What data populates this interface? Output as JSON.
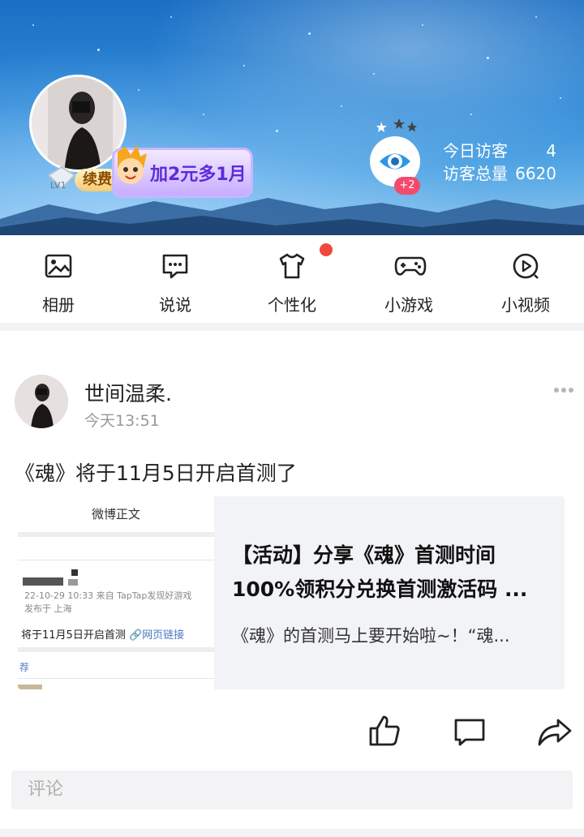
{
  "profile": {
    "level": "LV1",
    "renew_label": "续费",
    "promo_text": "加2元多1月",
    "visitor_badge": "+2",
    "today_visitors_label": "今日访客",
    "today_visitors_value": "4",
    "total_visitors_label": "访客总量",
    "total_visitors_value": "6620"
  },
  "nav": {
    "items": [
      {
        "label": "相册",
        "icon": "photo-album-icon"
      },
      {
        "label": "说说",
        "icon": "chat-bubble-icon"
      },
      {
        "label": "个性化",
        "icon": "tshirt-icon",
        "has_dot": true
      },
      {
        "label": "小游戏",
        "icon": "gamepad-icon"
      },
      {
        "label": "小视频",
        "icon": "play-circle-icon"
      }
    ]
  },
  "post": {
    "author": "世间温柔.",
    "time": "今天13:51",
    "text": "《魂》将于11月5日开启首测了",
    "card": {
      "thumb_header": "微博正文",
      "thumb_meta1": "22-10-29 10:33  来自 TapTap发现好游戏",
      "thumb_meta2": "发布于 上海",
      "thumb_main": "将于11月5日开启首测",
      "thumb_link": "网页链接",
      "thumb_footer": "荐",
      "title_line1": "【活动】分享《魂》首测时间",
      "title_line2": "100%领积分兑换首测激活码 ...",
      "desc": "《魂》的首测马上要开始啦~！“魂..."
    }
  },
  "comment": {
    "placeholder": "评论"
  },
  "colors": {
    "accent_red": "#f0493c",
    "promo_purple": "#5e2bd9",
    "link_blue": "#4a78c4"
  }
}
